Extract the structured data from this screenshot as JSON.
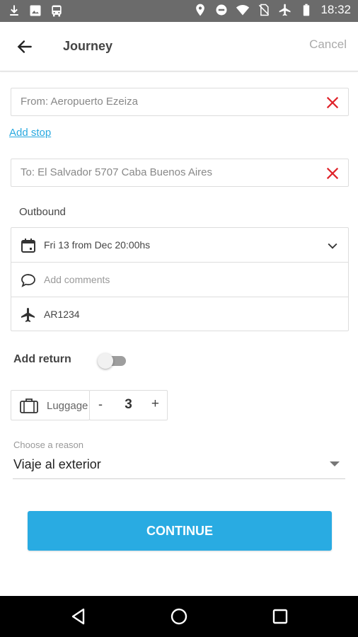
{
  "status_bar": {
    "time": "18:32",
    "left_icons": [
      "download-icon",
      "image-icon",
      "bus-icon"
    ],
    "right_icons": [
      "location-icon",
      "do-not-disturb-icon",
      "wifi-icon",
      "no-sim-icon",
      "airplane-mode-icon",
      "battery-icon"
    ]
  },
  "header": {
    "title": "Journey",
    "cancel_label": "Cancel"
  },
  "from_field": {
    "value": "From: Aeropuerto Ezeiza"
  },
  "add_stop_label": "Add stop",
  "to_field": {
    "value": "To: El Salvador 5707 Caba Buenos Aires"
  },
  "outbound": {
    "label": "Outbound",
    "date": "Fri 13 from Dec 20:00hs",
    "comments_placeholder": "Add comments",
    "flight": "AR1234"
  },
  "add_return": {
    "label": "Add return",
    "enabled": false
  },
  "luggage": {
    "label": "Luggage",
    "minus": "-",
    "count": "3",
    "plus": "+"
  },
  "reason": {
    "caption": "Choose a reason",
    "selected": "Viaje al exterior"
  },
  "continue_label": "CONTINUE",
  "colors": {
    "accent": "#29abe2",
    "clear": "#e0242b",
    "status_bar": "#6b6b6b"
  }
}
